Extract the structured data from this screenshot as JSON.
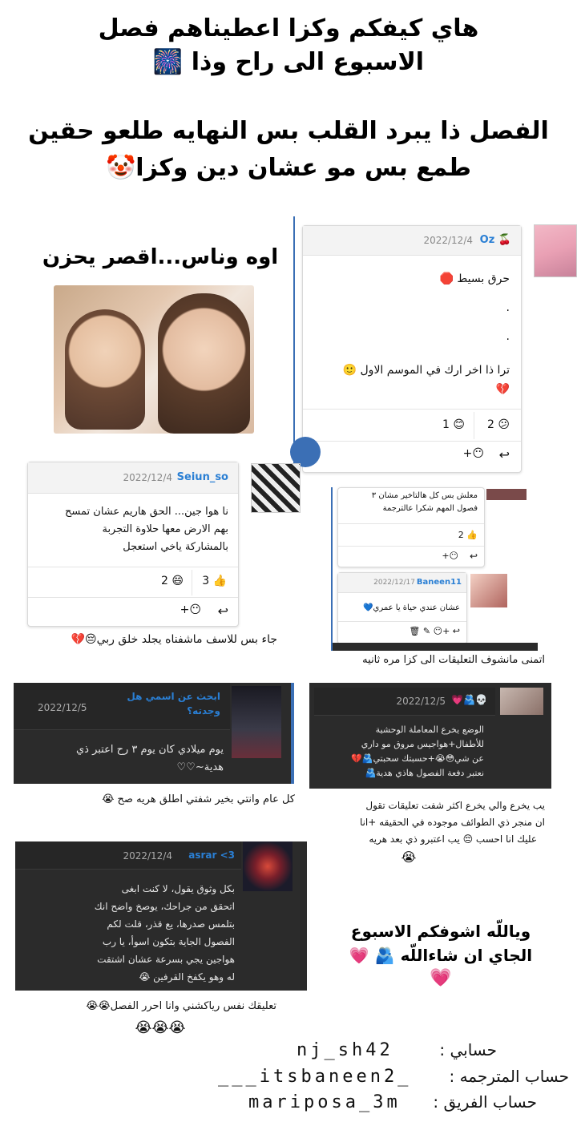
{
  "header": {
    "line1": "هاي كيفكم وكزا اعطيناهم فصل",
    "line2": "الاسبوع الى راح وذا 🎆",
    "line3": "الفصل ذا يبرد القلب بس النهايه طلعو حقين",
    "line4": "طمع بس مو عشان دين وكزا🤡"
  },
  "aside1": "اوه وناس...اقصر يحزن",
  "comment_oz": {
    "name": "Oz 🍒",
    "date": "2022/12/4",
    "line1": "حرق بسيط 🛑",
    "dot1": ".",
    "dot2": ".",
    "line2": "ترا ذا اخر ارك في الموسم الاول 🙂",
    "line3": "💔",
    "react_confused": "2 😕",
    "react_smile": "1 😊",
    "react_add": "+😶",
    "reply": "↩"
  },
  "comment_seiun": {
    "name": "Seiun_so",
    "date": "2022/12/4",
    "line1": "نا هوا جين... الحق هاريم عشان تمسح",
    "line2": "بهم الارض معها حلاوة التجربة",
    "line3": "بالمشاركة ياخي استعجل",
    "react_like": "3 👍",
    "react_laugh": "2 😄",
    "react_add": "+😶",
    "reply": "↩"
  },
  "caption_seiun": "جاء بس للاسف ماشفناه يجلد خلق ربي😔💔",
  "small_thread": {
    "top_line1": "معلش بس كل هالتاخير مشان ٣",
    "top_line2": "فصول المهم شكرا عالترجمة",
    "top_react": "2 👍",
    "top_add": "+😶",
    "top_reply": "↩",
    "reply_name": "Baneen11",
    "reply_date": "2022/12/17",
    "reply_text": "عشان عندي حياة يا عمري💙",
    "reply_icons": "↩ +😶 ✎ 🗑"
  },
  "caption_small": "اتمنى مانشوف التعليقات الى كزا مره ثانيه",
  "comment_dark1": {
    "name_line1": "ابحث عن اسمي هل",
    "name_line2": "وجدته؟",
    "date": "2022/12/5",
    "line1": "يوم ميلادي كان يوم ٣ رح اعتبر ذي",
    "line2": "هدية~♡♡"
  },
  "caption_dark1": "كل عام وانتي بخير شفتي اطلق هريه صح 😭",
  "comment_dark2": {
    "name": "💀🫂💗",
    "date": "2022/12/5",
    "line1": "الوضع يخرع المعاملة الوحشية",
    "line2": "للأطفال+هواجيس مروق مو داري",
    "line3": "عن شي😳😭+حسبتك سحبتي🫂💔",
    "line4": "نعتبر دفعة الفصول هاذي هدية🫂"
  },
  "caption_dark2": {
    "line1": "يب يخرع والي يخرع اكثر شفت تعليقات تقول",
    "line2": "ان منجر ذي الطوائف موجوده في الحقيقه +انا",
    "line3": "عليك انا احسب 😔 يب اعتبرو ذي بعد هريه",
    "line4": "😭"
  },
  "comment_asrar": {
    "name": "asrar <3",
    "date": "2022/12/4",
    "line1": "بكل وثوق يقول، لا كنت ابغى",
    "line2": "اتحقق من جراحك، يوصخ واضح انك",
    "line3": "بتلمس صدرها، يع قذر، قلت لكم",
    "line4": "الفصول الجاية بتكون اسوأ، يا رب",
    "line5": "هواجين يجي بسرعة عشان اشتقت",
    "line6": "له وهو يكفخ القرفين 😭"
  },
  "caption_asrar": {
    "line1": "تعليقك نفس رياكشني وانا احرر الفصل😭😭",
    "line2": "😭😭😭"
  },
  "farewell": {
    "line1": "وياللّه اشوفكم الاسبوع",
    "line2": "الجاي ان شاءاللّه 🫂 💗",
    "line3": "💗"
  },
  "credits": {
    "account_label": "حسابي :",
    "account_handle": "nj_sh42",
    "translator_label": "حساب المترجمه :",
    "translator_handle": "___itsbaneen2_",
    "team_label": "حساب الفريق :",
    "team_handle": "mariposa_3m"
  },
  "colors": {
    "blue": "#2a7fd4",
    "dark_card": "#2b2b2b",
    "accent_red": "#e53935"
  }
}
